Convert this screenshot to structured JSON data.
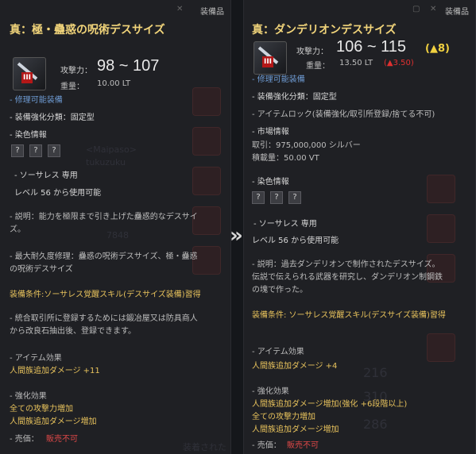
{
  "left": {
    "header": "装備品",
    "title": "真：極・蠱惑の呪術デスサイズ",
    "attack_label": "攻撃力：",
    "attack_value": "98 ~ 107",
    "weight_label": "重量：",
    "weight_value": "10.00 LT",
    "repairable": "- 修理可能装備",
    "enhance_type": "- 装備強化分類：固定型",
    "dye_header": "- 染色情報",
    "dye_slots": [
      "?",
      "?",
      "?"
    ],
    "class_only": "- ソーサレス 専用",
    "level_req": "レベル 56 から使用可能",
    "desc_1": "- 説明：能力を極限まで引き上げた蠱惑的なデスサイ",
    "desc_2": "ズ。",
    "maxdur_1": "- 最大耐久度修理：蠱惑の呪術デスサイズ、極・蠱惑",
    "maxdur_2": "の呪術デスサイズ",
    "equip_cond": "装備条件:ソーサレス覚醒スキル(デスサイズ装備)習得",
    "note_1": "- 統合取引所に登録するためには鍛冶屋又は防具商人",
    "note_2": "から改良石抽出後、登録できます。",
    "effect_header": "- アイテム効果",
    "effect_1": "人間族追加ダメージ +11",
    "enh_header": "- 強化効果",
    "enh_1": "全ての攻撃力増加",
    "enh_2": "人間族追加ダメージ増加",
    "price_label": "- 売価：",
    "price_value": "販売不可",
    "bg_1": "<Maipaso>",
    "bg_2": "tukuzuku",
    "bg_3": "7848",
    "bg_4": "装着されたネ"
  },
  "arrow": "»",
  "right": {
    "header": "装備品",
    "title": "真：ダンデリオンデスサイズ",
    "attack_label": "攻撃力：",
    "attack_value": "106 ~ 115",
    "attack_diff": "(▲8)",
    "weight_label": "重量：",
    "weight_value": "13.50 LT",
    "weight_diff": "(▲3.50)",
    "repairable": "- 修理可能装備",
    "enhance_type": "- 装備強化分類：固定型",
    "lock": "- アイテムロック(装備強化/取引所登録/捨てる不可)",
    "market_header": "- 市場情報",
    "market_price": "取引：975,000,000 シルバー",
    "market_weight": "積載量：50.00 VT",
    "dye_header": "- 染色情報",
    "dye_slots": [
      "?",
      "?",
      "?"
    ],
    "class_only": "- ソーサレス 専用",
    "level_req": "レベル 56 から使用可能",
    "desc_1": "- 説明：過去ダンデリオンで制作されたデスサイズ。",
    "desc_2": "伝説で伝えられる武器を研究し、ダンデリオン制鋼鉄",
    "desc_3": "の塊で作った。",
    "equip_cond": "装備条件: ソーサレス覚醒スキル(デスサイズ装備)習得",
    "effect_header": "- アイテム効果",
    "effect_1": "人間族追加ダメージ +4",
    "enh_header": "- 強化効果",
    "enh_1": "人間族追加ダメージ増加(強化 +6段階以上)",
    "enh_2": "全ての攻撃力増加",
    "enh_3": "人間族追加ダメージ増加",
    "price_label": "- 売価：",
    "price_value": "販売不可",
    "bg_1": "216",
    "bg_2": "310",
    "bg_3": "286"
  }
}
